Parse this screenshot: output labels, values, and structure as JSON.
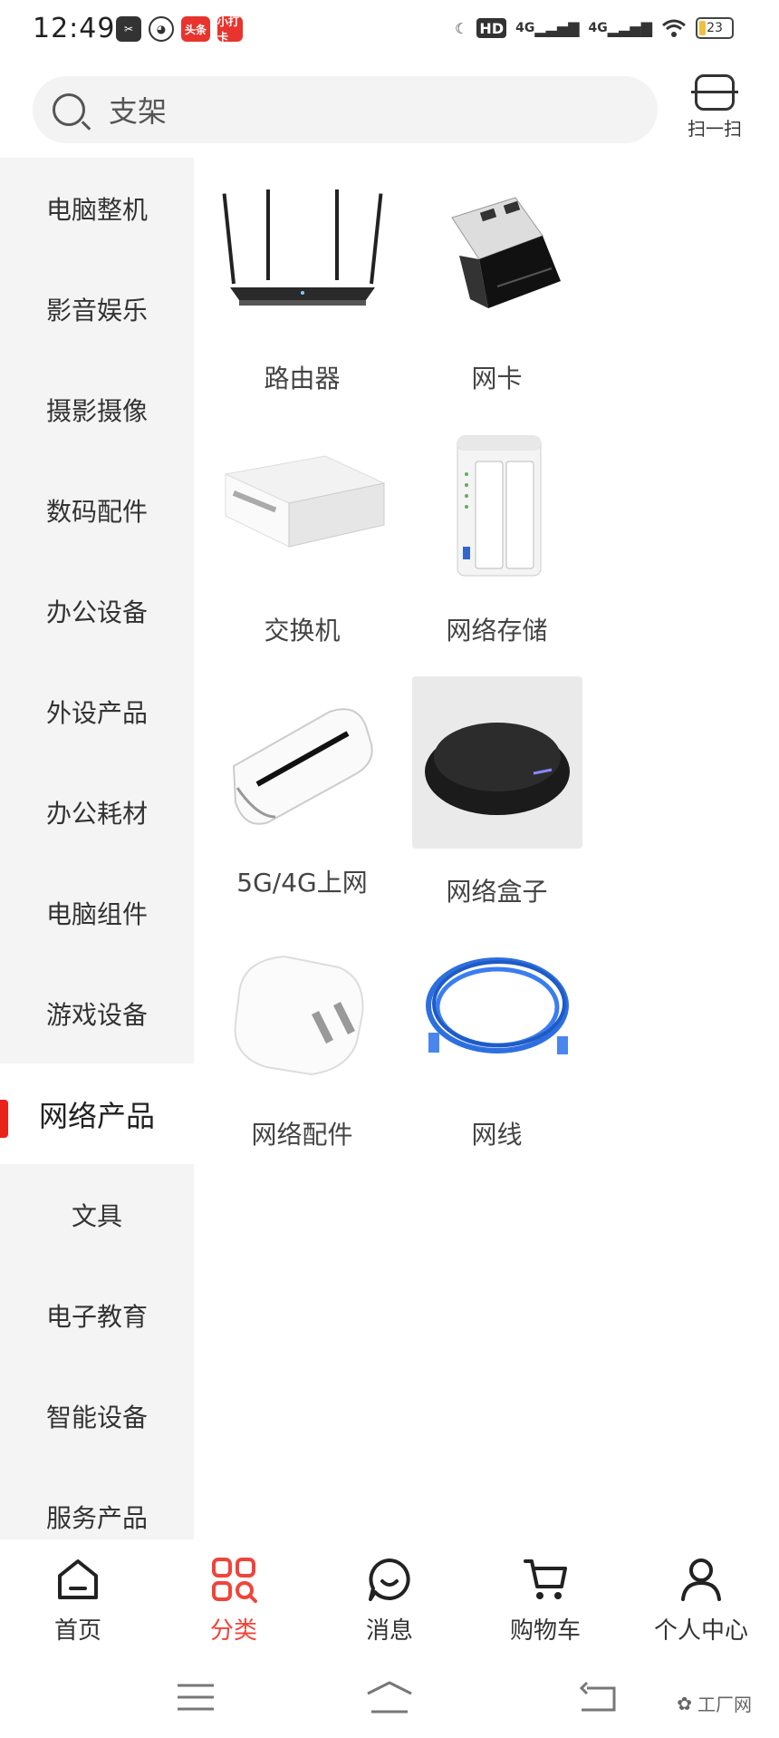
{
  "status_bar": {
    "time": "12:49",
    "notifications": [
      "app-icon",
      "wechat-icon",
      "头条",
      "小打卡"
    ],
    "hd_label": "HD",
    "network_1": "4G",
    "network_2": "4G",
    "battery": "23",
    "battery_level": 0.23
  },
  "search": {
    "placeholder": "支架",
    "scan_label": "扫一扫"
  },
  "sidebar": {
    "items": [
      {
        "label": "电脑整机"
      },
      {
        "label": "影音娱乐"
      },
      {
        "label": "摄影摄像"
      },
      {
        "label": "数码配件"
      },
      {
        "label": "办公设备"
      },
      {
        "label": "外设产品"
      },
      {
        "label": "办公耗材"
      },
      {
        "label": "电脑组件"
      },
      {
        "label": "游戏设备"
      },
      {
        "label": "网络产品",
        "active": true
      },
      {
        "label": "文具"
      },
      {
        "label": "电子教育"
      },
      {
        "label": "智能设备"
      },
      {
        "label": "服务产品"
      }
    ]
  },
  "grid": {
    "items": [
      {
        "label": "路由器",
        "icon": "router-icon"
      },
      {
        "label": "网卡",
        "icon": "usb-wifi-adapter-icon"
      },
      {
        "label": "交换机",
        "icon": "network-switch-icon"
      },
      {
        "label": "网络存储",
        "icon": "nas-icon"
      },
      {
        "label": "5G/4G上网",
        "icon": "mobile-hotspot-icon"
      },
      {
        "label": "网络盒子",
        "icon": "network-box-icon"
      },
      {
        "label": "网络配件",
        "icon": "power-adapter-icon"
      },
      {
        "label": "网线",
        "icon": "ethernet-cable-icon"
      }
    ]
  },
  "tabs": [
    {
      "label": "首页",
      "icon": "home-icon"
    },
    {
      "label": "分类",
      "icon": "category-icon",
      "active": true
    },
    {
      "label": "消息",
      "icon": "message-icon"
    },
    {
      "label": "购物车",
      "icon": "cart-icon"
    },
    {
      "label": "个人中心",
      "icon": "profile-icon"
    }
  ],
  "nav_bar": {
    "watermark": "工厂网"
  },
  "colors": {
    "accent": "#e8231a",
    "active_tab": "#f0443a",
    "sidebar_bg": "#f4f4f4"
  }
}
